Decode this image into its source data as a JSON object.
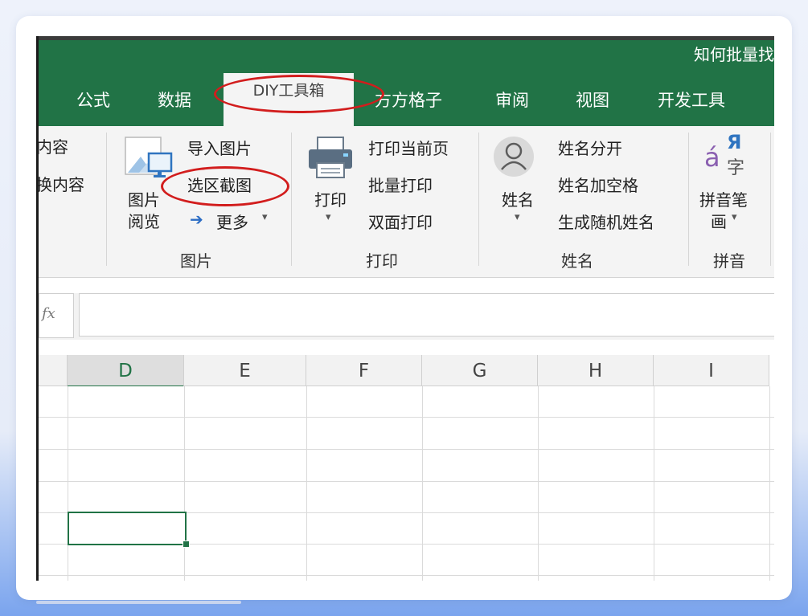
{
  "window": {
    "title": "知何批量找"
  },
  "tabs": [
    {
      "label": "公式"
    },
    {
      "label": "数据"
    },
    {
      "label": "DIY工具箱",
      "active": true
    },
    {
      "label": "方方格子"
    },
    {
      "label": "审阅"
    },
    {
      "label": "视图"
    },
    {
      "label": "开发工具"
    }
  ],
  "ribbon": {
    "clipped_group": {
      "item1": "内容",
      "item2": "换内容"
    },
    "picture_group": {
      "label": "图片",
      "browse_label_line1": "图片",
      "browse_label_line2": "阅览",
      "import_picture": "导入图片",
      "region_screenshot": "选区截图",
      "more": "更多",
      "more_arrow": "➔",
      "more_caret": "▾"
    },
    "print_group": {
      "label": "打印",
      "print_button": "打印",
      "print_caret": "▾",
      "print_current_page": "打印当前页",
      "batch_print": "批量打印",
      "duplex_print": "双面打印"
    },
    "name_group": {
      "label": "姓名",
      "name_button": "姓名",
      "name_caret": "▾",
      "split_name": "姓名分开",
      "add_space": "姓名加空格",
      "random_name": "生成随机姓名"
    },
    "pinyin_group": {
      "label": "拼音",
      "icon_a": "á",
      "icon_ya": "Я",
      "icon_zi": "字",
      "button_line1": "拼音笔",
      "button_line2": "画",
      "caret": "▾"
    }
  },
  "formula_bar": {
    "fx": "fx",
    "value": ""
  },
  "columns": [
    "D",
    "E",
    "F",
    "G",
    "H",
    "I"
  ],
  "selected_column": "D",
  "colors": {
    "excel_green": "#217346",
    "annotation_red": "#d21d1d"
  }
}
